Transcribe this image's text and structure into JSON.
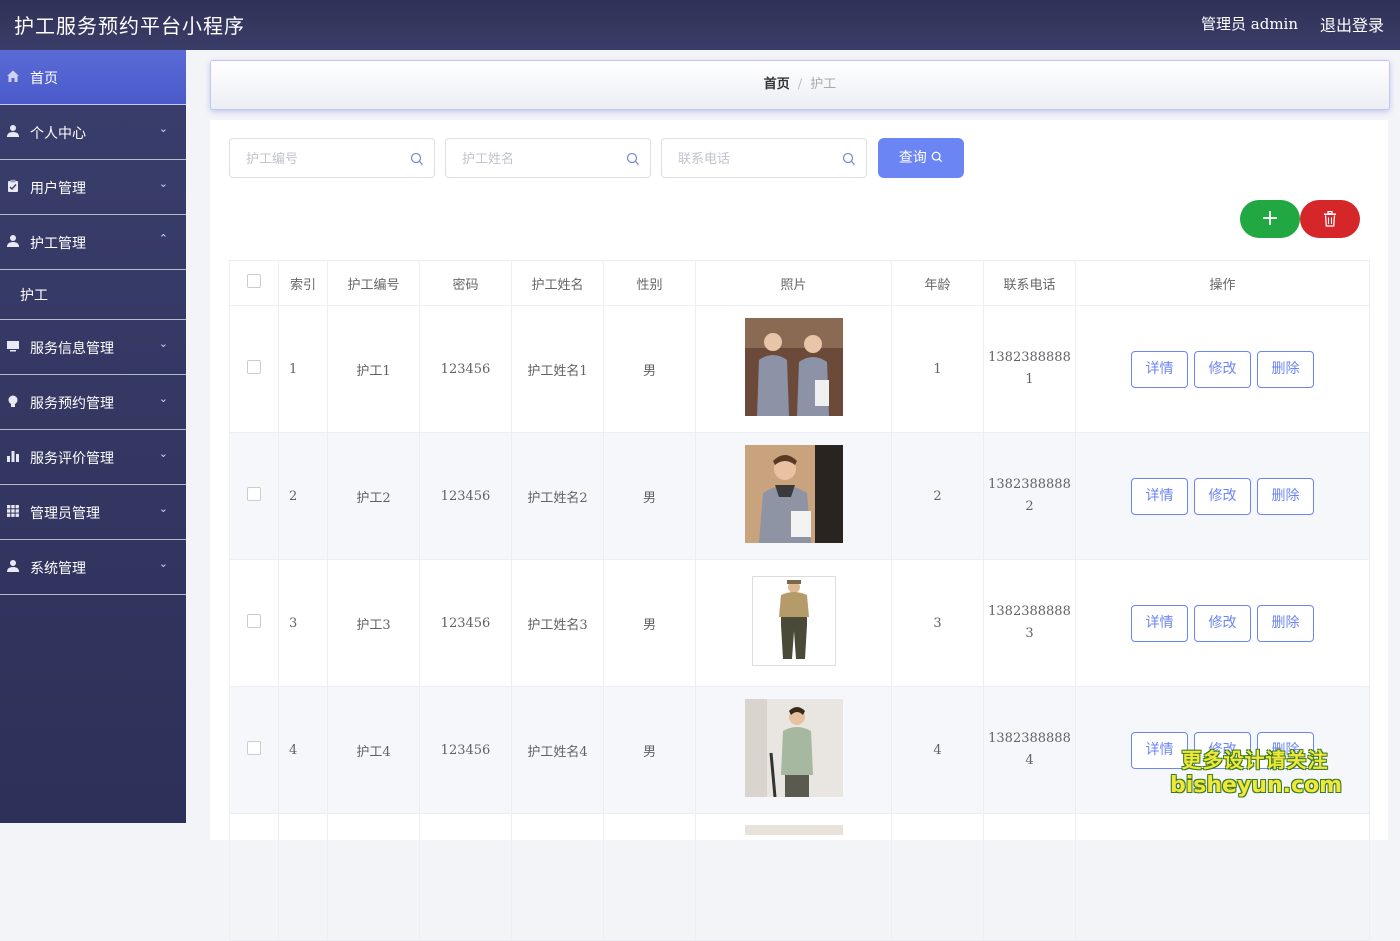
{
  "header": {
    "app_title": "护工服务预约平台小程序",
    "user_label": "管理员 admin",
    "logout_label": "退出登录"
  },
  "sidebar": {
    "items": [
      {
        "label": "首页",
        "icon": "home-icon"
      },
      {
        "label": "个人中心",
        "icon": "user-icon"
      },
      {
        "label": "用户管理",
        "icon": "clipboard-icon"
      },
      {
        "label": "护工管理",
        "icon": "user-icon"
      },
      {
        "label": "护工",
        "icon": ""
      },
      {
        "label": "服务信息管理",
        "icon": "monitor-icon"
      },
      {
        "label": "服务预约管理",
        "icon": "lightbulb-icon"
      },
      {
        "label": "服务评价管理",
        "icon": "bar-chart-icon"
      },
      {
        "label": "管理员管理",
        "icon": "grid-icon"
      },
      {
        "label": "系统管理",
        "icon": "user-icon"
      }
    ],
    "active_color": "#5a6bd8"
  },
  "breadcrumb": {
    "home": "首页",
    "separator": "/",
    "current": "护工"
  },
  "search": {
    "worker_no_placeholder": "护工编号",
    "worker_name_placeholder": "护工姓名",
    "phone_placeholder": "联系电话",
    "query_label": "查询"
  },
  "toolbar": {
    "add_label": "+",
    "add_color": "#22a843",
    "delete_color": "#d5262a"
  },
  "table": {
    "headers": [
      "索引",
      "护工编号",
      "密码",
      "护工姓名",
      "性别",
      "照片",
      "年龄",
      "联系电话",
      "操作"
    ],
    "rows": [
      {
        "index": "1",
        "worker_no": "护工1",
        "password": "123456",
        "name": "护工姓名1",
        "gender": "男",
        "age": "1",
        "phone_a": "1382388888",
        "phone_b": "1"
      },
      {
        "index": "2",
        "worker_no": "护工2",
        "password": "123456",
        "name": "护工姓名2",
        "gender": "男",
        "age": "2",
        "phone_a": "1382388888",
        "phone_b": "2"
      },
      {
        "index": "3",
        "worker_no": "护工3",
        "password": "123456",
        "name": "护工姓名3",
        "gender": "男",
        "age": "3",
        "phone_a": "1382388888",
        "phone_b": "3"
      },
      {
        "index": "4",
        "worker_no": "护工4",
        "password": "123456",
        "name": "护工姓名4",
        "gender": "男",
        "age": "4",
        "phone_a": "1382388888",
        "phone_b": "4"
      }
    ],
    "actions": {
      "detail": "详情",
      "edit": "修改",
      "delete": "删除"
    }
  },
  "watermark": {
    "line1": "更多设计请关注",
    "line2": "bisheyun.com"
  }
}
